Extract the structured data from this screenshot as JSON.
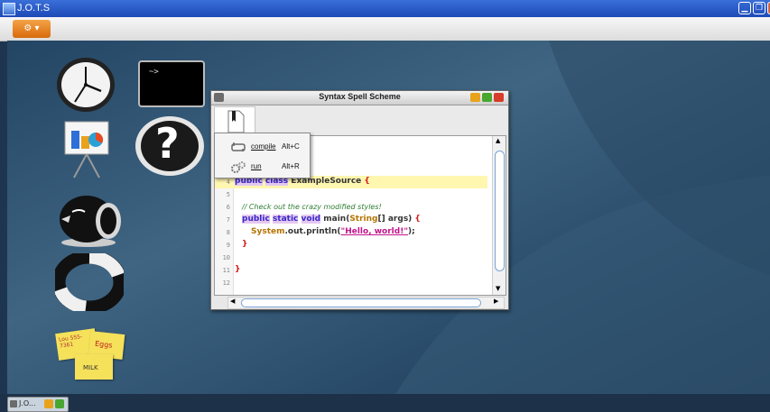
{
  "window": {
    "title": "J.O.T.S"
  },
  "menubar": {
    "java_button": "⚙ ▾"
  },
  "desktop_icons": [
    "clock-icon",
    "terminal-icon",
    "presentation-icon",
    "help-icon",
    "chat-bird-icon",
    "lifebuoy-icon",
    "sticky-notes-icon"
  ],
  "terminal": {
    "prompt": "~>"
  },
  "help": {
    "symbol": "?"
  },
  "sticky_notes": {
    "note1": "Lou 555-7361",
    "note2": "Eggs",
    "note3": "MILK"
  },
  "editor_window": {
    "title": "Syntax Spell Scheme",
    "lines": [
      {
        "n": "4",
        "text": "public class ExampleSource {"
      },
      {
        "n": "5",
        "text": ""
      },
      {
        "n": "6",
        "text": "// Check out the crazy modified styles!"
      },
      {
        "n": "7",
        "text": "public static void main(String[] args) {"
      },
      {
        "n": "8",
        "text": "System.out.println(\"Hello, world!\");"
      },
      {
        "n": "9",
        "text": "}"
      },
      {
        "n": "10",
        "text": ""
      },
      {
        "n": "11",
        "text": "}"
      },
      {
        "n": "12",
        "text": ""
      }
    ]
  },
  "popup_menu": {
    "items": [
      {
        "label": "compile",
        "accelerator": "Alt+C"
      },
      {
        "label": "run",
        "accelerator": "Alt+R"
      }
    ]
  },
  "taskbar": {
    "item_label": "J.O..."
  },
  "colors": {
    "titlebar": "#2a5ad0",
    "desktop": "#2e5373",
    "accent_orange": "#e0811f",
    "keyword": "#3a28c9"
  }
}
